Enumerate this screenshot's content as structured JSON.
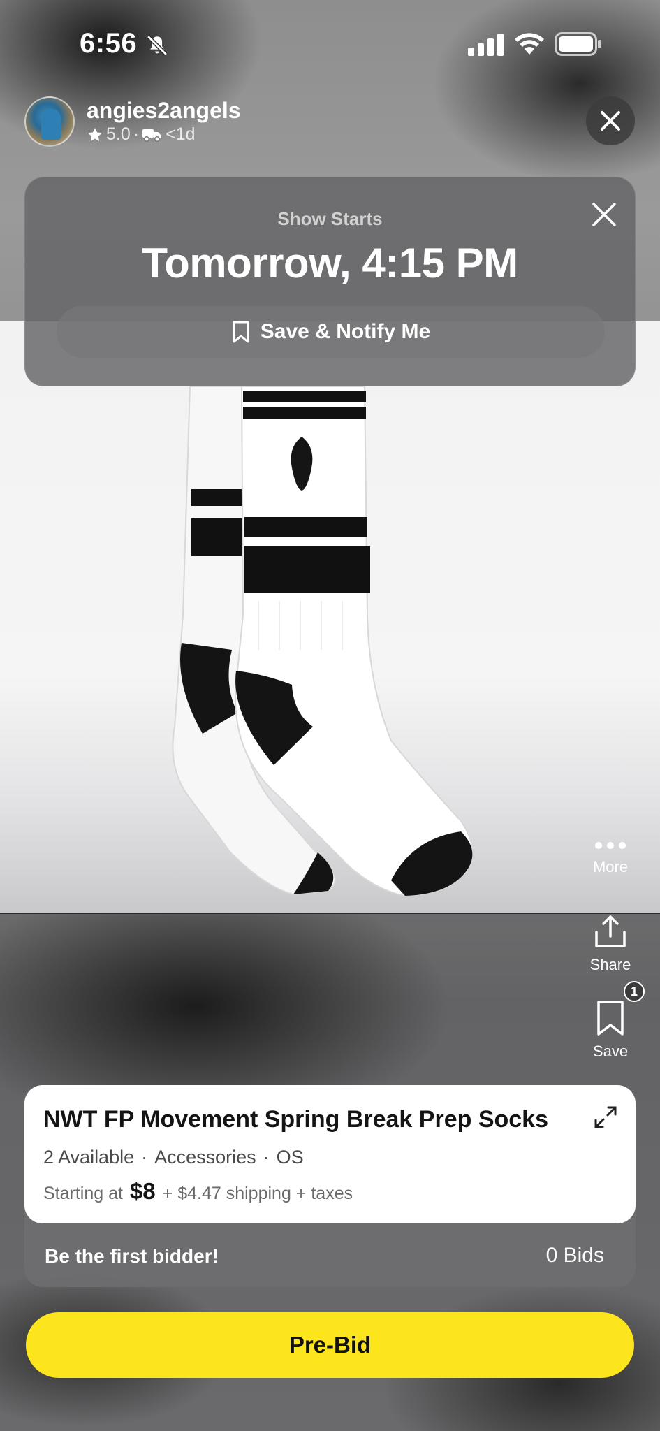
{
  "status_bar": {
    "time": "6:56",
    "icons": [
      "bell-off-icon",
      "signal-icon",
      "wifi-icon",
      "battery-icon"
    ]
  },
  "seller": {
    "name": "angies2angels",
    "rating": "5.0",
    "shipping": "<1d"
  },
  "show_card": {
    "label": "Show Starts",
    "time": "Tomorrow, 4:15 PM",
    "notify_button": "Save & Notify Me"
  },
  "side_actions": {
    "more": "More",
    "share": "Share",
    "save": "Save",
    "save_badge": "1"
  },
  "product": {
    "title": "NWT FP Movement Spring Break Prep Socks",
    "available": "2 Available",
    "category": "Accessories",
    "size": "OS",
    "starting_label": "Starting at",
    "price": "$8",
    "shipping": "+ $4.47 shipping + taxes"
  },
  "bids": {
    "prompt": "Be the first bidder!",
    "count": "0 Bids"
  },
  "prebid_button": "Pre-Bid",
  "colors": {
    "accent": "#fde51d",
    "card": "#ffffff"
  }
}
